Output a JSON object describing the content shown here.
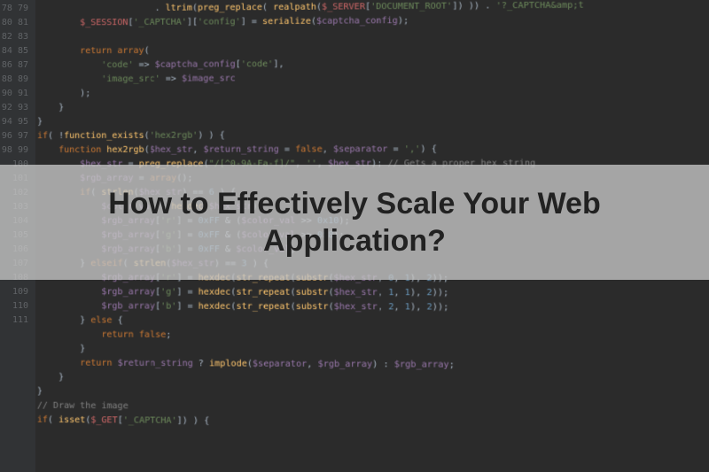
{
  "overlay": {
    "title": "How to Effectively Scale Your Web Application?"
  },
  "gutter": {
    "start": 78,
    "end": 111
  },
  "code": {
    "lines": [
      {
        "indent": 3,
        "html": "          <span class='op'>.</span> <span class='fn'>ltrim</span><span class='op'>(</span><span class='fn'>preg_replace</span><span class='op'>(</span> <span class='fn'>realpath</span><span class='op'>(</span><span class='global'>$_SERVER</span><span class='op'>[</span><span class='str'>'DOCUMENT_ROOT'</span><span class='op'>]) )) .</span> <span class='str'>'?_CAPTCHA&amp;amp;t</span>"
      },
      {
        "indent": 2,
        "html": "<span class='global'>$_SESSION</span><span class='op'>[</span><span class='str'>'_CAPTCHA'</span><span class='op'>][</span><span class='str'>'config'</span><span class='op'>] =</span> <span class='fn'>serialize</span><span class='op'>(</span><span class='var'>$captcha_config</span><span class='op'>);</span>"
      },
      {
        "indent": 2,
        "html": ""
      },
      {
        "indent": 2,
        "html": "<span class='kw'>return</span> <span class='kw'>array</span><span class='op'>(</span>"
      },
      {
        "indent": 3,
        "html": "<span class='str'>'code'</span> <span class='op'>=&gt;</span> <span class='var'>$captcha_config</span><span class='op'>[</span><span class='str'>'code'</span><span class='op'>],</span>"
      },
      {
        "indent": 3,
        "html": "<span class='str'>'image_src'</span> <span class='op'>=&gt;</span> <span class='var'>$image_src</span>"
      },
      {
        "indent": 2,
        "html": "<span class='op'>);</span>"
      },
      {
        "indent": 1,
        "html": "<span class='op'>}</span>"
      },
      {
        "indent": 0,
        "html": "<span class='op'>}</span>"
      },
      {
        "indent": 0,
        "html": ""
      },
      {
        "indent": 0,
        "html": "<span class='kw'>if</span><span class='op'>( !</span><span class='fn'>function_exists</span><span class='op'>(</span><span class='str'>'hex2rgb'</span><span class='op'>) ) {</span>"
      },
      {
        "indent": 1,
        "html": "<span class='kw'>function</span> <span class='fn'>hex2rgb</span><span class='op'>(</span><span class='var'>$hex_str</span><span class='op'>,</span> <span class='var'>$return_string</span> <span class='op'>=</span> <span class='kw'>false</span><span class='op'>,</span> <span class='var'>$separator</span> <span class='op'>=</span> <span class='str'>','</span><span class='op'>) {</span>"
      },
      {
        "indent": 2,
        "html": "<span class='var'>$hex_str</span> <span class='op'>=</span> <span class='fn'>preg_replace</span><span class='op'>(</span><span class='str'>\"/[^0-9A-Fa-f]/\"</span><span class='op'>,</span> <span class='str'>''</span><span class='op'>,</span> <span class='var'>$hex_str</span><span class='op'>);</span> <span class='cmt'>// Gets a proper hex string</span>"
      },
      {
        "indent": 2,
        "html": "<span class='var'>$rgb_array</span> <span class='op'>=</span> <span class='kw'>array</span><span class='op'>();</span>"
      },
      {
        "indent": 2,
        "html": "<span class='kw'>if</span><span class='op'>(</span> <span class='fn'>strlen</span><span class='op'>(</span><span class='var'>$hex_str</span><span class='op'>) ==</span> <span class='num'>6</span> <span class='op'>) {</span>"
      },
      {
        "indent": 3,
        "html": "<span class='var'>$color_val</span> <span class='op'>=</span> <span class='fn'>hexdec</span><span class='op'>(</span><span class='var'>$hex_str</span><span class='op'>);</span>"
      },
      {
        "indent": 3,
        "html": "<span class='var'>$rgb_array</span><span class='op'>[</span><span class='str'>'r'</span><span class='op'>] =</span> <span class='num'>0xFF</span> <span class='op'>&amp; (</span><span class='var'>$color_val</span> <span class='op'>&gt;&gt;</span> <span class='num'>0x10</span><span class='op'>);</span>"
      },
      {
        "indent": 3,
        "html": "<span class='var'>$rgb_array</span><span class='op'>[</span><span class='str'>'g'</span><span class='op'>] =</span> <span class='num'>0xFF</span> <span class='op'>&amp; (</span><span class='var'>$color_val</span> <span class='op'>&gt;&gt;</span> <span class='num'>0x8</span><span class='op'>);</span>"
      },
      {
        "indent": 3,
        "html": "<span class='var'>$rgb_array</span><span class='op'>[</span><span class='str'>'b'</span><span class='op'>] =</span> <span class='num'>0xFF</span> <span class='op'>&amp;</span> <span class='var'>$color_val</span><span class='op'>;</span>"
      },
      {
        "indent": 2,
        "html": "<span class='op'>}</span> <span class='kw'>elseif</span><span class='op'>(</span> <span class='fn'>strlen</span><span class='op'>(</span><span class='var'>$hex_str</span><span class='op'>) ==</span> <span class='num'>3</span> <span class='op'>) {</span>"
      },
      {
        "indent": 3,
        "html": "<span class='var'>$rgb_array</span><span class='op'>[</span><span class='str'>'r'</span><span class='op'>] =</span> <span class='fn'>hexdec</span><span class='op'>(</span><span class='fn'>str_repeat</span><span class='op'>(</span><span class='fn'>substr</span><span class='op'>(</span><span class='var'>$hex_str</span><span class='op'>,</span> <span class='num'>0</span><span class='op'>,</span> <span class='num'>1</span><span class='op'>),</span> <span class='num'>2</span><span class='op'>));</span>"
      },
      {
        "indent": 3,
        "html": "<span class='var'>$rgb_array</span><span class='op'>[</span><span class='str'>'g'</span><span class='op'>] =</span> <span class='fn'>hexdec</span><span class='op'>(</span><span class='fn'>str_repeat</span><span class='op'>(</span><span class='fn'>substr</span><span class='op'>(</span><span class='var'>$hex_str</span><span class='op'>,</span> <span class='num'>1</span><span class='op'>,</span> <span class='num'>1</span><span class='op'>),</span> <span class='num'>2</span><span class='op'>));</span>"
      },
      {
        "indent": 3,
        "html": "<span class='var'>$rgb_array</span><span class='op'>[</span><span class='str'>'b'</span><span class='op'>] =</span> <span class='fn'>hexdec</span><span class='op'>(</span><span class='fn'>str_repeat</span><span class='op'>(</span><span class='fn'>substr</span><span class='op'>(</span><span class='var'>$hex_str</span><span class='op'>,</span> <span class='num'>2</span><span class='op'>,</span> <span class='num'>1</span><span class='op'>),</span> <span class='num'>2</span><span class='op'>));</span>"
      },
      {
        "indent": 2,
        "html": "<span class='op'>}</span> <span class='kw'>else</span> <span class='op'>{</span>"
      },
      {
        "indent": 3,
        "html": "<span class='kw'>return</span> <span class='kw'>false</span><span class='op'>;</span>"
      },
      {
        "indent": 2,
        "html": "<span class='op'>}</span>"
      },
      {
        "indent": 2,
        "html": "<span class='kw'>return</span> <span class='var'>$return_string</span> <span class='op'>?</span> <span class='fn'>implode</span><span class='op'>(</span><span class='var'>$separator</span><span class='op'>,</span> <span class='var'>$rgb_array</span><span class='op'>) :</span> <span class='var'>$rgb_array</span><span class='op'>;</span>"
      },
      {
        "indent": 1,
        "html": "<span class='op'>}</span>"
      },
      {
        "indent": 0,
        "html": "<span class='op'>}</span>"
      },
      {
        "indent": 0,
        "html": ""
      },
      {
        "indent": 0,
        "html": "<span class='cmt'>// Draw the image</span>"
      },
      {
        "indent": 0,
        "html": "<span class='kw'>if</span><span class='op'>(</span> <span class='fn'>isset</span><span class='op'>(</span><span class='global'>$_GET</span><span class='op'>[</span><span class='str'>'_CAPTCHA'</span><span class='op'>]) ) {</span>"
      },
      {
        "indent": 0,
        "html": ""
      },
      {
        "indent": 0,
        "html": ""
      }
    ]
  }
}
